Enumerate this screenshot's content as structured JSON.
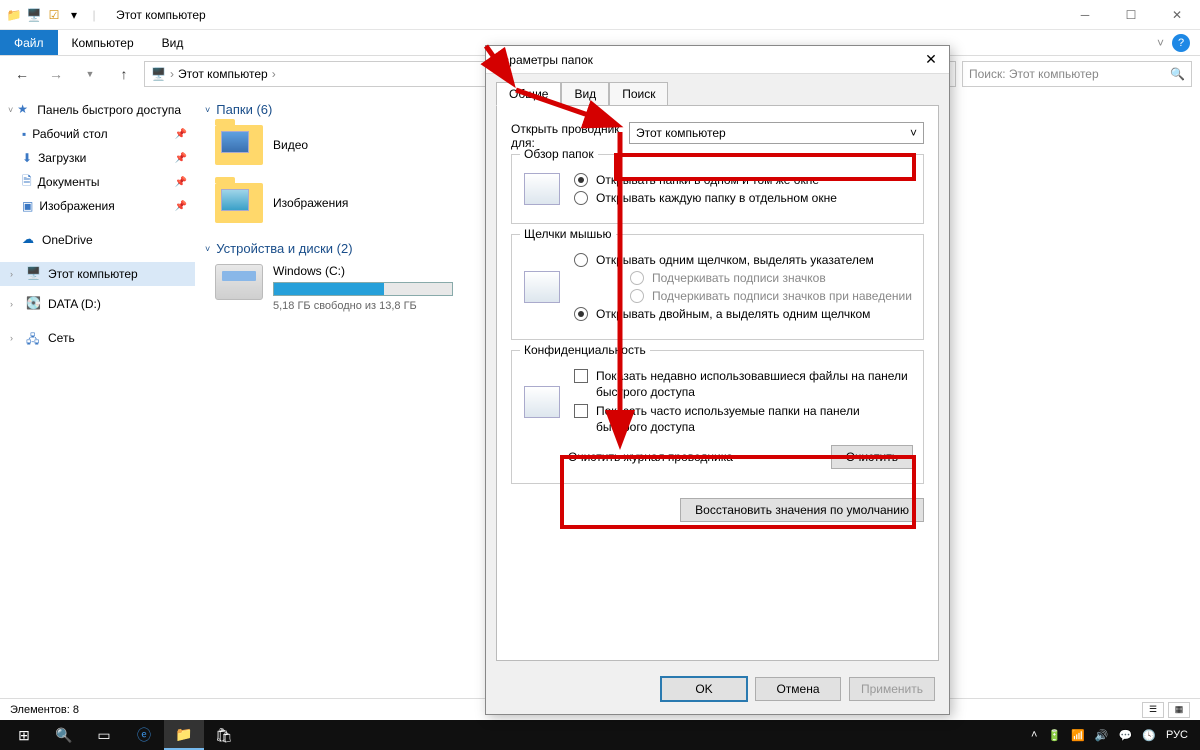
{
  "titlebar": {
    "title": "Этот компьютер"
  },
  "ribbon": {
    "file": "Файл",
    "computer": "Компьютер",
    "view": "Вид"
  },
  "nav": {
    "breadcrumb_root": "Этот компьютер",
    "search_placeholder": "Поиск: Этот компьютер"
  },
  "sidebar": {
    "quick_access": "Панель быстрого доступа",
    "items": [
      {
        "label": "Рабочий стол"
      },
      {
        "label": "Загрузки"
      },
      {
        "label": "Документы"
      },
      {
        "label": "Изображения"
      }
    ],
    "onedrive": "OneDrive",
    "this_pc": "Этот компьютер",
    "data_d": "DATA (D:)",
    "network": "Сеть"
  },
  "content": {
    "folders_header": "Папки (6)",
    "folder_video": "Видео",
    "folder_images": "Изображения",
    "devices_header": "Устройства и диски (2)",
    "drive_c_label": "Windows (C:)",
    "drive_c_sub": "5,18 ГБ свободно из 13,8 ГБ"
  },
  "statusbar": {
    "elements": "Элементов: 8"
  },
  "dialog": {
    "title": "Параметры папок",
    "tabs": {
      "general": "Общие",
      "view": "Вид",
      "search": "Поиск"
    },
    "open_explorer_label": "Открыть проводник для:",
    "open_explorer_value": "Этот компьютер",
    "browse_legend": "Обзор папок",
    "browse_r1": "Открывать папки в одном и том же окне",
    "browse_r2": "Открывать каждую папку в отдельном окне",
    "click_legend": "Щелчки мышью",
    "click_r1": "Открывать одним щелчком, выделять указателем",
    "click_sub1": "Подчеркивать подписи значков",
    "click_sub2": "Подчеркивать подписи значков при наведении",
    "click_r2": "Открывать двойным, а выделять одним щелчком",
    "privacy_legend": "Конфиденциальность",
    "privacy_c1": "Показать недавно использовавшиеся файлы на панели быстрого доступа",
    "privacy_c2": "Показать часто используемые папки на панели быстрого доступа",
    "clear_history": "Очистить журнал проводника",
    "clear_btn": "Очистить",
    "restore_btn": "Восстановить значения по умолчанию",
    "ok": "OK",
    "cancel": "Отмена",
    "apply": "Применить"
  },
  "taskbar": {
    "lang": "РУС"
  }
}
